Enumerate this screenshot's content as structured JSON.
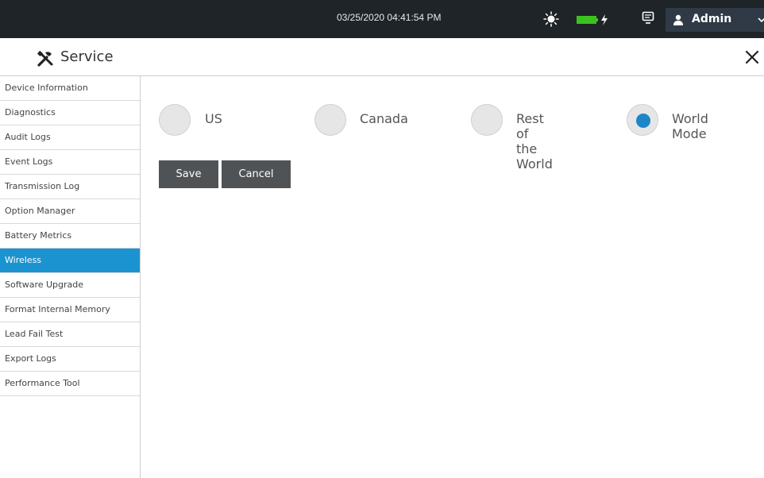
{
  "topbar": {
    "datetime": "03/25/2020 04:41:54 PM",
    "user_name": "Admin",
    "battery_color": "#3cc21f"
  },
  "header": {
    "title": "Service"
  },
  "sidebar": {
    "items": [
      {
        "label": "Device Information"
      },
      {
        "label": "Diagnostics"
      },
      {
        "label": "Audit Logs"
      },
      {
        "label": "Event Logs"
      },
      {
        "label": "Transmission Log"
      },
      {
        "label": "Option Manager"
      },
      {
        "label": "Battery Metrics"
      },
      {
        "label": "Wireless"
      },
      {
        "label": "Software Upgrade"
      },
      {
        "label": "Format Internal Memory"
      },
      {
        "label": "Lead Fail Test"
      },
      {
        "label": "Export Logs"
      },
      {
        "label": "Performance Tool"
      }
    ],
    "active_index": 7,
    "active_color": "#1b93d1"
  },
  "region": {
    "options": [
      {
        "label": "US",
        "selected": false
      },
      {
        "label": "Canada",
        "selected": false
      },
      {
        "label": "Rest of the World",
        "selected": false
      },
      {
        "label": "World Mode",
        "selected": true
      }
    ]
  },
  "actions": {
    "save_label": "Save",
    "cancel_label": "Cancel"
  }
}
